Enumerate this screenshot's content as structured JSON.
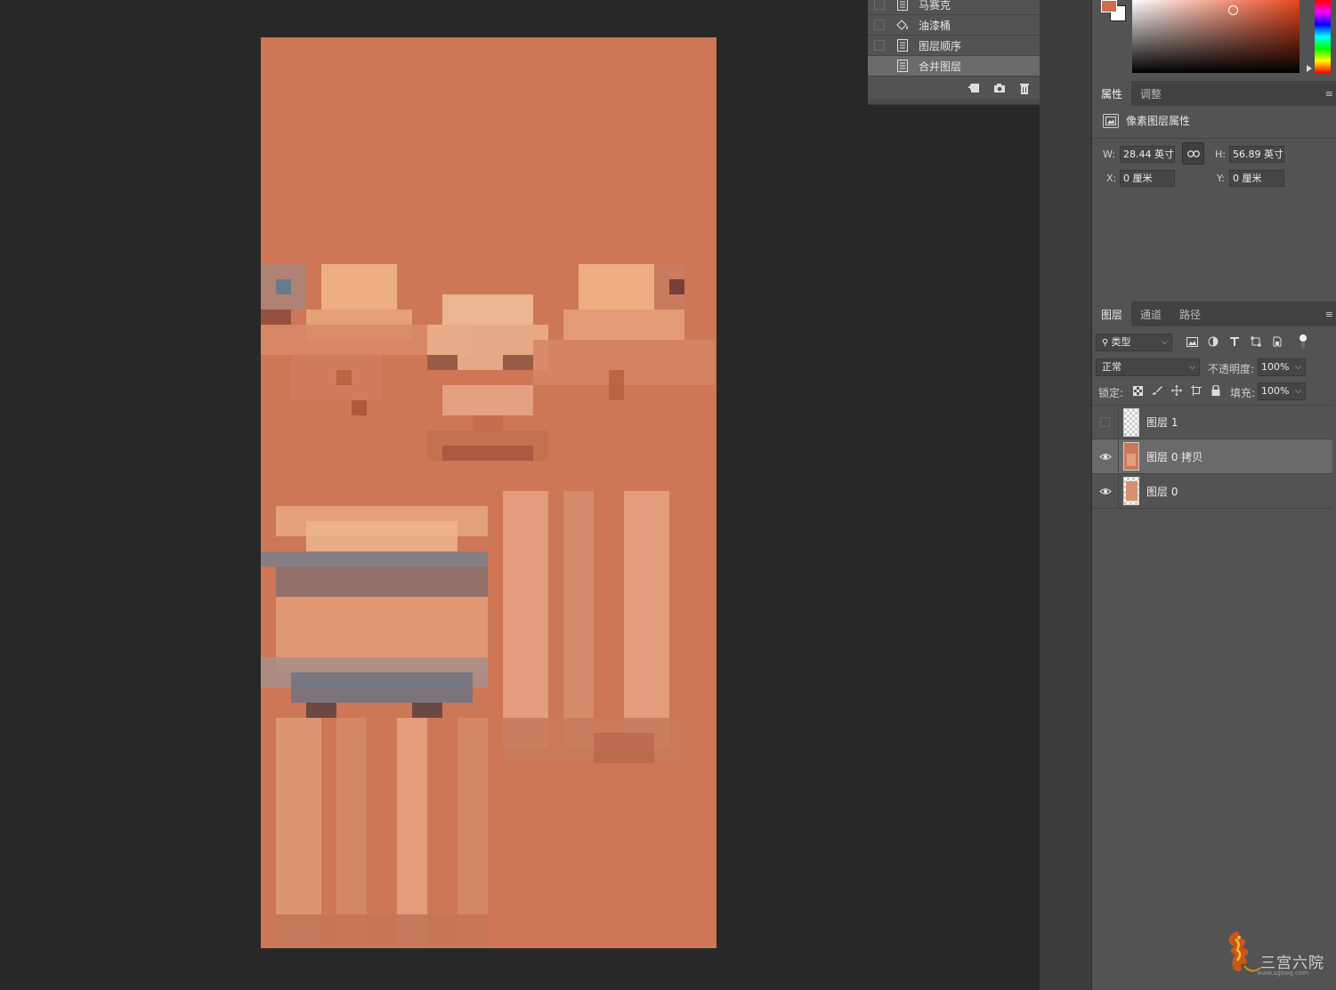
{
  "history": {
    "items": [
      {
        "label": "马赛克",
        "icon": "document-icon"
      },
      {
        "label": "油漆桶",
        "icon": "paint-bucket-icon"
      },
      {
        "label": "图层顺序",
        "icon": "document-icon"
      },
      {
        "label": "合并图层",
        "icon": "document-icon",
        "selected": true
      }
    ]
  },
  "properties": {
    "tabs": [
      "属性",
      "调整"
    ],
    "active_tab": "属性",
    "section_title": "像素图层属性",
    "w_label": "W:",
    "w_value": "28.44 英寸",
    "h_label": "H:",
    "h_value": "56.89 英寸",
    "x_label": "X:",
    "x_value": "0 厘米",
    "y_label": "Y:",
    "y_value": "0 厘米"
  },
  "layers_panel": {
    "tabs": [
      "图层",
      "通道",
      "路径"
    ],
    "active_tab": "图层",
    "filter_kind": "类型",
    "blend_mode": "正常",
    "opacity_label": "不透明度:",
    "opacity_value": "100%",
    "lock_label": "锁定:",
    "fill_label": "填充:",
    "fill_value": "100%",
    "layers": [
      {
        "name": "图层 1",
        "visible": false,
        "selected": false
      },
      {
        "name": "图层 0 拷贝",
        "visible": true,
        "selected": true
      },
      {
        "name": "图层 0",
        "visible": true,
        "selected": false
      }
    ]
  },
  "colors": {
    "foreground": "#cd6d4f",
    "background": "#ffffff",
    "canvas_fill": "#cd7757"
  },
  "watermark": {
    "text": "三宫六院",
    "url": "www.sgljwg.com"
  }
}
